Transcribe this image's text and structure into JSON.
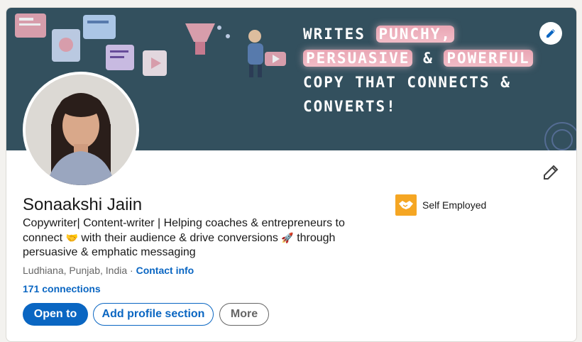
{
  "profile": {
    "name": "Sonaakshi Jaiin",
    "headline_part1": "Copywriter| Content-writer | Helping coaches & entrepreneurs to connect ",
    "headline_part2": "with their audience & drive conversions ",
    "headline_part3": "through persuasive & emphatic messaging",
    "emoji_handshake": "🤝",
    "emoji_rocket": "🚀",
    "location": "Ludhiana, Punjab, India",
    "location_separator": " · ",
    "contact_info": "Contact info",
    "connections": "171 connections"
  },
  "banner": {
    "line1_a": "WRITES ",
    "line1_hl": "PUNCHY,",
    "line2_hl1": "PERSUASIVE",
    "line2_mid": " & ",
    "line2_hl2": "POWERFUL",
    "line3": "COPY THAT CONNECTS &",
    "line4": "CONVERTS!"
  },
  "actions": {
    "open_to": "Open to",
    "add_section": "Add profile section",
    "more": "More"
  },
  "company": {
    "name": "Self Employed"
  },
  "colors": {
    "accent": "#0a66c2",
    "banner_bg": "#33505e",
    "highlight": "#f4c6cf",
    "company_logo": "#f5a623"
  },
  "icons": {
    "edit_banner": "pencil-icon",
    "edit_intro": "pencil-icon",
    "company_logo": "handshake-icon"
  }
}
